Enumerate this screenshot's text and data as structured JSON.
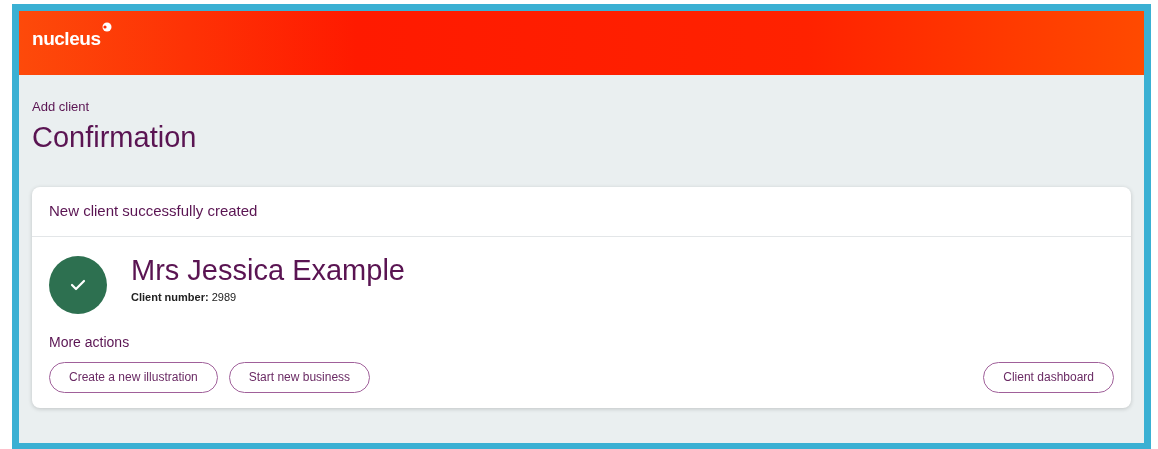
{
  "header": {
    "logo": "nucleus"
  },
  "breadcrumb": "Add client",
  "title": "Confirmation",
  "card": {
    "heading": "New client successfully created",
    "client": {
      "name": "Mrs Jessica Example",
      "number_label": "Client number:",
      "number": "2989"
    },
    "more_actions_label": "More actions",
    "actions": [
      "Create a new illustration",
      "Start new business"
    ],
    "dashboard_button": "Client dashboard"
  }
}
